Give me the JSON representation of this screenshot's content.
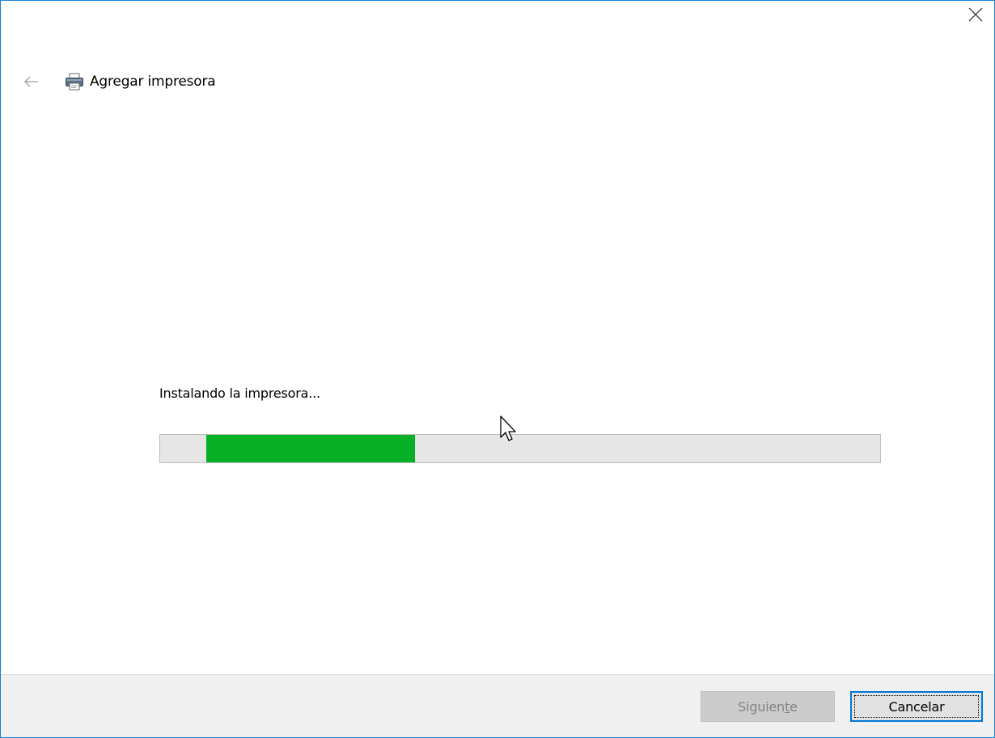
{
  "window": {
    "close_label": "Close"
  },
  "header": {
    "title": "Agregar impresora",
    "back_icon": "back-arrow-icon",
    "printer_icon": "printer-icon"
  },
  "main": {
    "status_text": "Instalando la impresora...",
    "progress": {
      "value_fraction": 0.29,
      "color": "#06b025"
    }
  },
  "footer": {
    "next_label_prefix": "Siguien",
    "next_label_mnemonic": "t",
    "next_label_suffix": "e",
    "next_enabled": false,
    "cancel_label": "Cancelar",
    "cancel_focused": true
  },
  "colors": {
    "accent": "#0078d7",
    "progress_fill": "#06b025",
    "progress_track": "#e6e6e6",
    "footer_bg": "#f0f0f0"
  }
}
